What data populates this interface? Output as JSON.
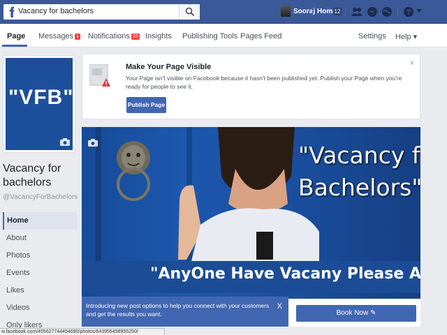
{
  "topbar": {
    "logo": "f",
    "search_value": "Vacancy for bachelors",
    "profile_name": "Sooraj",
    "home_label": "Home",
    "home_count": "12"
  },
  "pagenav": {
    "page": "Page",
    "messages": "Messages",
    "messages_count": "1",
    "notifications": "Notifications",
    "notifications_count": "20",
    "insights": "Insights",
    "publishing_tools": "Publishing Tools",
    "pages_feed": "Pages Feed",
    "settings": "Settings",
    "help": "Help ▾"
  },
  "profile": {
    "picture_text": "\"VFB\"",
    "name": "Vacancy for bachelors",
    "handle": "@VacancyForBachelors"
  },
  "sidebar": {
    "items": [
      {
        "label": "Home"
      },
      {
        "label": "About"
      },
      {
        "label": "Photos"
      },
      {
        "label": "Events"
      },
      {
        "label": "Likes"
      },
      {
        "label": "Videos"
      },
      {
        "label": "Only likers"
      }
    ]
  },
  "notice": {
    "title": "Make Your Page Visible",
    "body": "Your Page isn't visible on Facebook because it hasn't been published yet. Publish your Page when you're ready for people to see it.",
    "close": "×",
    "button": "Publish Page"
  },
  "cover": {
    "title_line1": "\"Vacancy fo",
    "title_line2": "Bachelors\"",
    "banner": "\"AnyOne Have Vacany Please Adjust Me"
  },
  "tooltip": {
    "text": "Introducing new post options to help you connect with your customers and get the results you want.",
    "close": "X"
  },
  "book_button": "Book Now ✎",
  "status_url": "w.facebook.com/455627744454690/photos/643955458955250/",
  "colors": {
    "brand": "#3b5998",
    "accent": "#4267b2",
    "badge": "#fa3e3e",
    "cover": "#1a4f9f"
  }
}
